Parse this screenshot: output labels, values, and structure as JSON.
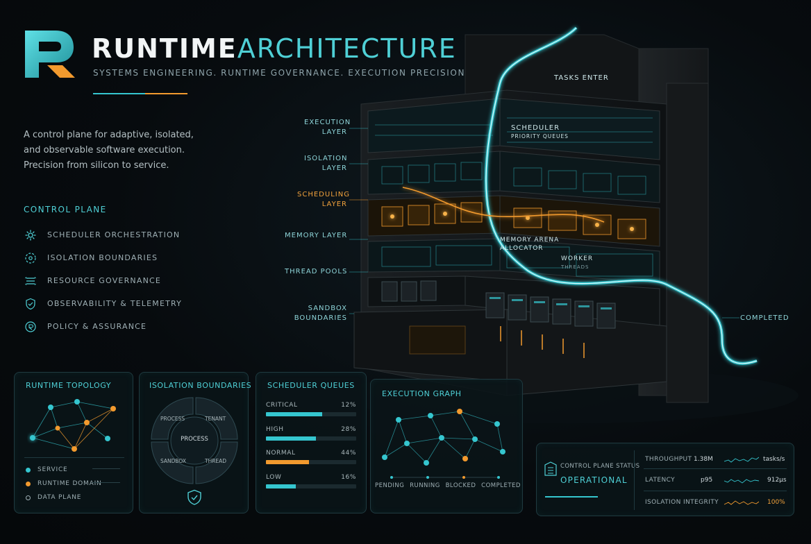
{
  "header": {
    "title_part1": "RUNTIME",
    "title_part2": "ARCHITECTURE",
    "subtitle": "SYSTEMS ENGINEERING. RUNTIME GOVERNANCE. EXECUTION PRECISION.",
    "logo_icon": "r-monogram-logo"
  },
  "intro": {
    "line1": "A control plane for adaptive, isolated,",
    "line2": "and observable software execution.",
    "line3": "Precision from silicon to service."
  },
  "control_plane": {
    "title": "CONTROL PLANE",
    "items": [
      {
        "label": "SCHEDULER ORCHESTRATION",
        "icon": "gear-icon"
      },
      {
        "label": "ISOLATION BOUNDARIES",
        "icon": "boundary-icon"
      },
      {
        "label": "RESOURCE GOVERNANCE",
        "icon": "resource-icon"
      },
      {
        "label": "OBSERVABILITY & TELEMETRY",
        "icon": "shield-icon"
      },
      {
        "label": "POLICY & ASSURANCE",
        "icon": "policy-icon"
      }
    ]
  },
  "building": {
    "labels": {
      "tasks_enter": "TASKS ENTER",
      "execution_layer_1": "EXECUTION",
      "execution_layer_2": "LAYER",
      "isolation_layer_1": "ISOLATION",
      "isolation_layer_2": "LAYER",
      "scheduling_layer_1": "SCHEDULING",
      "scheduling_layer_2": "LAYER",
      "memory_layer": "MEMORY LAYER",
      "thread_pools": "THREAD POOLS",
      "sandbox_1": "SANDBOX",
      "sandbox_2": "BOUNDARIES",
      "completed": "COMPLETED",
      "scheduler": "SCHEDULER",
      "priority_queues": "PRIORITY QUEUES",
      "memory_arena_1": "MEMORY ARENA",
      "memory_arena_2": "ALLOCATOR",
      "worker": "WORKER",
      "threads": "THREADS"
    },
    "colors": {
      "cyan": "#35c6cf",
      "orange": "#f29a2e"
    }
  },
  "topology": {
    "title": "RUNTIME TOPOLOGY",
    "legend": [
      {
        "label": "SERVICE",
        "color": "#35c6cf"
      },
      {
        "label": "RUNTIME DOMAIN",
        "color": "#f29a2e"
      },
      {
        "label": "DATA PLANE",
        "color": "outline"
      }
    ]
  },
  "isolation": {
    "title": "ISOLATION BOUNDARIES",
    "center": "PROCESS",
    "segments": [
      "PROCESS",
      "TENANT",
      "SANDBOX",
      "THREAD"
    ]
  },
  "scheduler": {
    "title": "SCHEDULER QUEUES",
    "queues": [
      {
        "name": "CRITICAL",
        "pct_label": "12%",
        "fill": 0.62,
        "color": "#35c6cf"
      },
      {
        "name": "HIGH",
        "pct_label": "28%",
        "fill": 0.55,
        "color": "#35c6cf"
      },
      {
        "name": "NORMAL",
        "pct_label": "44%",
        "fill": 0.48,
        "color": "#f29a2e"
      },
      {
        "name": "LOW",
        "pct_label": "16%",
        "fill": 0.33,
        "color": "#35c6cf"
      }
    ]
  },
  "graph": {
    "title": "EXECUTION GRAPH",
    "steps": [
      "PENDING",
      "RUNNING",
      "BLOCKED",
      "COMPLETED"
    ]
  },
  "status": {
    "title": "CONTROL PLANE STATUS",
    "state": "OPERATIONAL",
    "metrics": [
      {
        "label": "THROUGHPUT",
        "value": "1.38M",
        "unit": "tasks/s"
      },
      {
        "label": "LATENCY",
        "value": "p95",
        "unit": "912μs"
      },
      {
        "label": "ISOLATION INTEGRITY",
        "value": "",
        "unit": "100%"
      }
    ]
  }
}
